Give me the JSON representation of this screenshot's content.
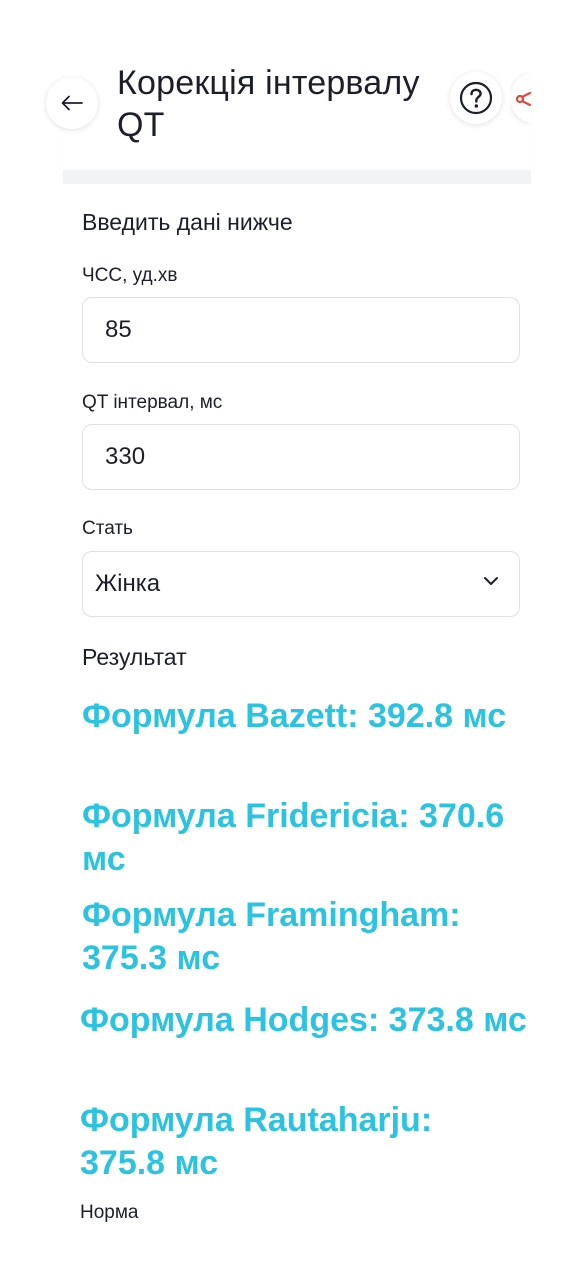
{
  "header": {
    "title": "Корекція інтервалу QT",
    "back_icon": "arrow-left-icon",
    "help_icon": "question-circle-icon",
    "share_icon": "share-icon"
  },
  "form": {
    "section_title": "Введить дані нижче",
    "hr": {
      "label": "ЧСС, уд.хв",
      "value": "85"
    },
    "qt": {
      "label": "QT інтервал, мс",
      "value": "330"
    },
    "sex": {
      "label": "Стать",
      "value": "Жінка"
    }
  },
  "results": {
    "title": "Результат",
    "items": [
      "Формула Bazett: 392.8 мс",
      "Формула Fridericia: 370.6 мс",
      "Формула Framingham: 375.3 мс",
      "Формула Hodges: 373.8 мс",
      "Формула Rautaharju: 375.8 мс"
    ],
    "status": "Норма"
  },
  "colors": {
    "accent": "#2bc3df",
    "text": "#1c1f2a",
    "share_accent": "#e0483e"
  }
}
